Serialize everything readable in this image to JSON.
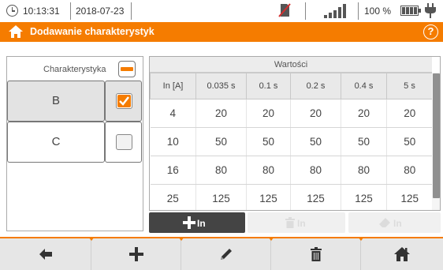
{
  "status_bar": {
    "time": "10:13:31",
    "date": "2018-07-23",
    "battery_percent": "100 %",
    "icons": [
      "clock-icon",
      "no-sd-card-icon",
      "signal-strength-icon",
      "battery-icon",
      "power-plug-icon"
    ]
  },
  "title_bar": {
    "title": "Dodawanie charakterystyk",
    "icons": [
      "home-icon",
      "help-icon"
    ],
    "help_symbol": "?"
  },
  "characteristics": {
    "header_label": "Charakterystyka",
    "items": [
      {
        "name": "B",
        "checked": true,
        "selected": true
      },
      {
        "name": "C",
        "checked": false,
        "selected": false
      }
    ]
  },
  "values_table": {
    "header": "Wartości",
    "columns": [
      "In [A]",
      "0.035 s",
      "0.1 s",
      "0.2 s",
      "0.4 s",
      "5 s"
    ],
    "rows": [
      [
        "4",
        "20",
        "20",
        "20",
        "20",
        "20"
      ],
      [
        "10",
        "50",
        "50",
        "50",
        "50",
        "50"
      ],
      [
        "16",
        "80",
        "80",
        "80",
        "80",
        "80"
      ],
      [
        "25",
        "125",
        "125",
        "125",
        "125",
        "125"
      ]
    ]
  },
  "actions": {
    "add_in_label": "In",
    "delete_in_label": "In",
    "edit_in_label": "In"
  },
  "bottom_bar": {
    "buttons": [
      "back-arrow-icon",
      "plus-icon",
      "pencil-icon",
      "trash-icon",
      "home-icon"
    ]
  },
  "colors": {
    "accent": "#f57c00",
    "dark_button": "#444444",
    "selected_row": "#e3e3e3"
  }
}
